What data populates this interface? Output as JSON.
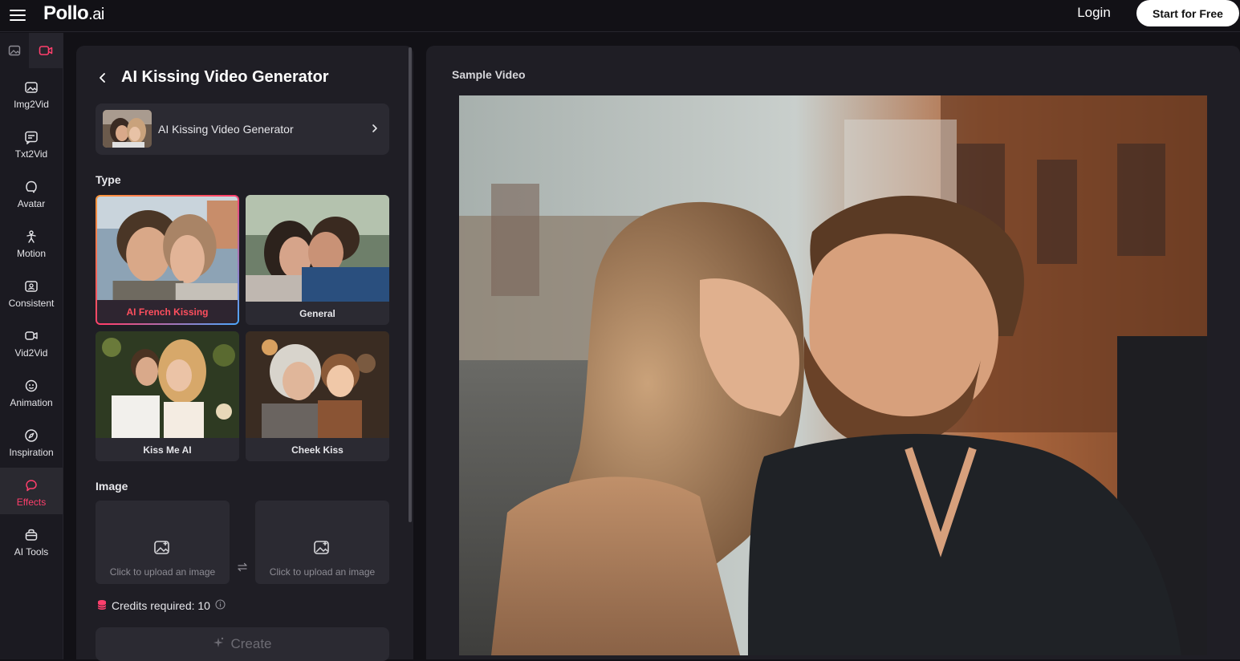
{
  "header": {
    "logo_main": "Pollo",
    "logo_suffix": ".ai",
    "login_label": "Login",
    "start_label": "Start for Free"
  },
  "sidebar": {
    "items": [
      {
        "label": "Img2Vid",
        "icon": "image-to-video-icon"
      },
      {
        "label": "Txt2Vid",
        "icon": "text-to-video-icon"
      },
      {
        "label": "Avatar",
        "icon": "avatar-icon"
      },
      {
        "label": "Motion",
        "icon": "motion-icon"
      },
      {
        "label": "Consistent",
        "icon": "consistent-icon"
      },
      {
        "label": "Vid2Vid",
        "icon": "video-to-video-icon"
      },
      {
        "label": "Animation",
        "icon": "animation-icon"
      },
      {
        "label": "Inspiration",
        "icon": "compass-icon"
      },
      {
        "label": "Effects",
        "icon": "effects-icon"
      },
      {
        "label": "AI Tools",
        "icon": "toolbox-icon"
      }
    ],
    "active": "Effects"
  },
  "panel": {
    "title": "AI Kissing Video Generator",
    "effect_name": "AI Kissing Video Generator",
    "type_label": "Type",
    "types": [
      {
        "label": "AI French Kissing",
        "selected": true
      },
      {
        "label": "General",
        "selected": false
      },
      {
        "label": "Kiss Me AI",
        "selected": false
      },
      {
        "label": "Cheek Kiss",
        "selected": false
      }
    ],
    "image_label": "Image",
    "upload_text_1": "Click to upload an image",
    "upload_text_2": "Click to upload an image",
    "credits_text": "Credits required: 10",
    "create_label": "Create"
  },
  "preview": {
    "label": "Sample Video"
  },
  "colors": {
    "accent": "#ff3f6c",
    "background": "#121116",
    "panel": "#1f1e25",
    "card": "#2b2a32"
  }
}
